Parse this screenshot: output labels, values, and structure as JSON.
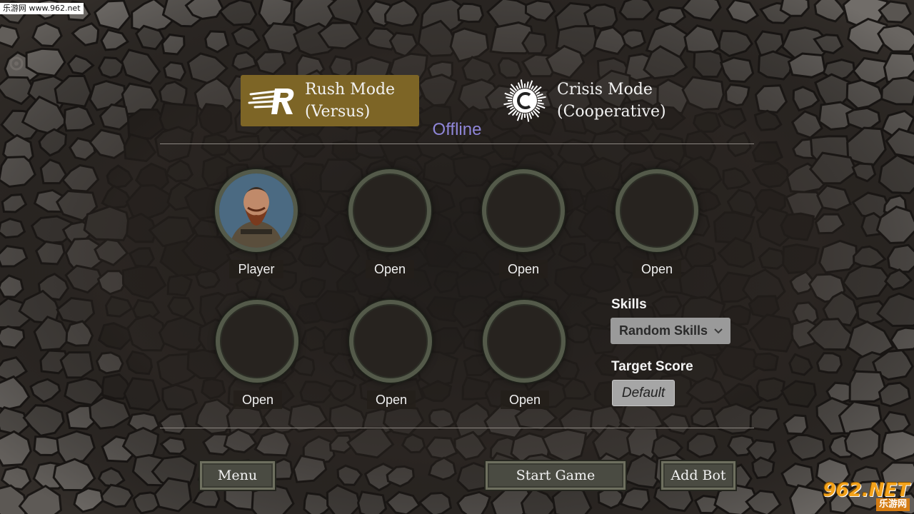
{
  "watermark": {
    "top": "乐游网 www.962.net",
    "bottom_main": "962.NET",
    "bottom_sub": "乐游网"
  },
  "modes": [
    {
      "line1": "Rush Mode",
      "line2": "(Versus)",
      "active": true,
      "icon": "rush-r-icon"
    },
    {
      "line1": "Crisis Mode",
      "line2": "(Cooperative)",
      "active": false,
      "icon": "crisis-c-icon"
    }
  ],
  "status": "Offline",
  "slots": [
    {
      "label": "Player",
      "filled": true
    },
    {
      "label": "Open",
      "filled": false
    },
    {
      "label": "Open",
      "filled": false
    },
    {
      "label": "Open",
      "filled": false
    },
    {
      "label": "Open",
      "filled": false
    },
    {
      "label": "Open",
      "filled": false
    },
    {
      "label": "Open",
      "filled": false
    }
  ],
  "settings": {
    "skills_title": "Skills",
    "skills_value": "Random Skills",
    "target_title": "Target Score",
    "target_value": "Default"
  },
  "buttons": {
    "menu": "Menu",
    "start": "Start Game",
    "add_bot": "Add Bot"
  },
  "colors": {
    "active_mode": "#7d6526",
    "status_text": "#8f86d8",
    "watermark": "#f3a21a"
  }
}
